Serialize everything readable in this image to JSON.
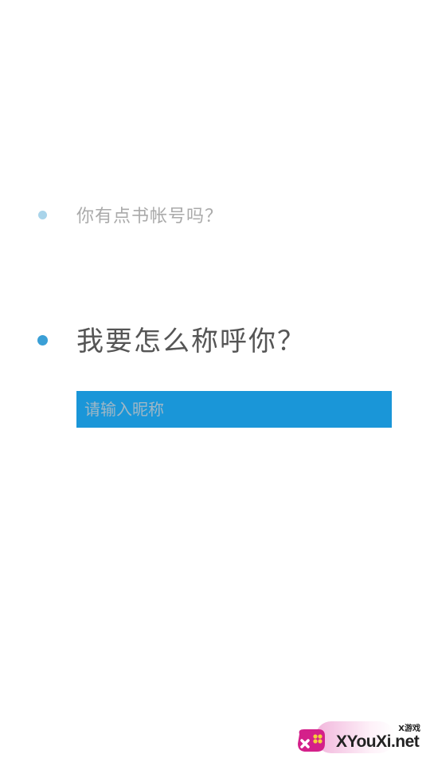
{
  "colors": {
    "accent": "#1a96d8",
    "dot_inactive": "#a9d4ea",
    "dot_active": "#3a9fd6",
    "text_inactive": "#aaaaaa",
    "text_active": "#555555"
  },
  "steps": [
    {
      "question": "你有点书帐号吗？",
      "state": "inactive"
    },
    {
      "question": "我要怎么称呼你？",
      "state": "active"
    }
  ],
  "nickname_input": {
    "placeholder": "请输入昵称",
    "value": ""
  },
  "watermark": {
    "tag": "X游戏",
    "site": "XYouXi.net",
    "logo_icon": "gamepad-icon"
  }
}
